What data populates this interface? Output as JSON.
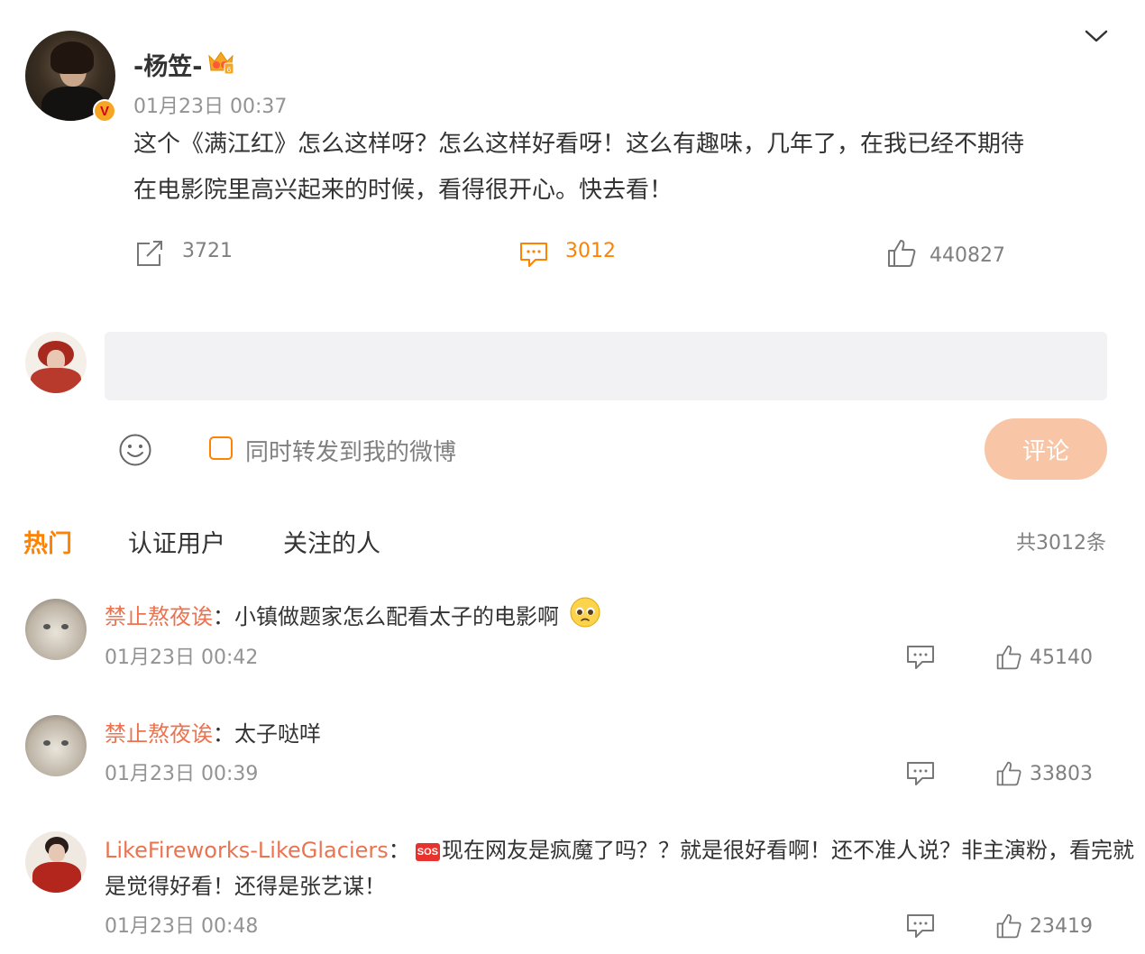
{
  "post": {
    "author": "-杨笠-",
    "time": "01月23日 00:37",
    "text_line1": "这个《满江红》怎么这样呀？怎么这样好看呀！这么有趣味，几年了，在我已经不期待",
    "text_line2": "在电影院里高兴起来的时候，看得很开心。快去看！",
    "reposts": "3721",
    "comments": "3012",
    "likes": "440827"
  },
  "composer": {
    "input_value": "",
    "repost_checkbox_label": "同时转发到我的微博",
    "submit_label": "评论"
  },
  "tabs": {
    "hot": "热门",
    "verified": "认证用户",
    "following": "关注的人",
    "total": "共3012条"
  },
  "comments": [
    {
      "user": "禁止熬夜诶",
      "sep": "：",
      "text": "小镇做题家怎么配看太子的电影啊",
      "time": "01月23日 00:42",
      "likes": "45140"
    },
    {
      "user": "禁止熬夜诶",
      "sep": "：",
      "text": "太子哒咩",
      "time": "01月23日 00:39",
      "likes": "33803"
    },
    {
      "user": "LikeFireworks-LikeGlaciers",
      "sep": "：",
      "badge": "SOS",
      "text_line1": "现在网友是疯魔了吗？？就是很好看啊！还不准人说？非主演粉，看完就",
      "text_line2": "是觉得好看！还得是张艺谋！",
      "time": "01月23日 00:48",
      "likes": "23419"
    }
  ],
  "colors": {
    "accent": "#ff8200",
    "username": "#eb7350",
    "submit_disabled": "#f8c6a6",
    "input_bg": "#f2f2f5"
  }
}
